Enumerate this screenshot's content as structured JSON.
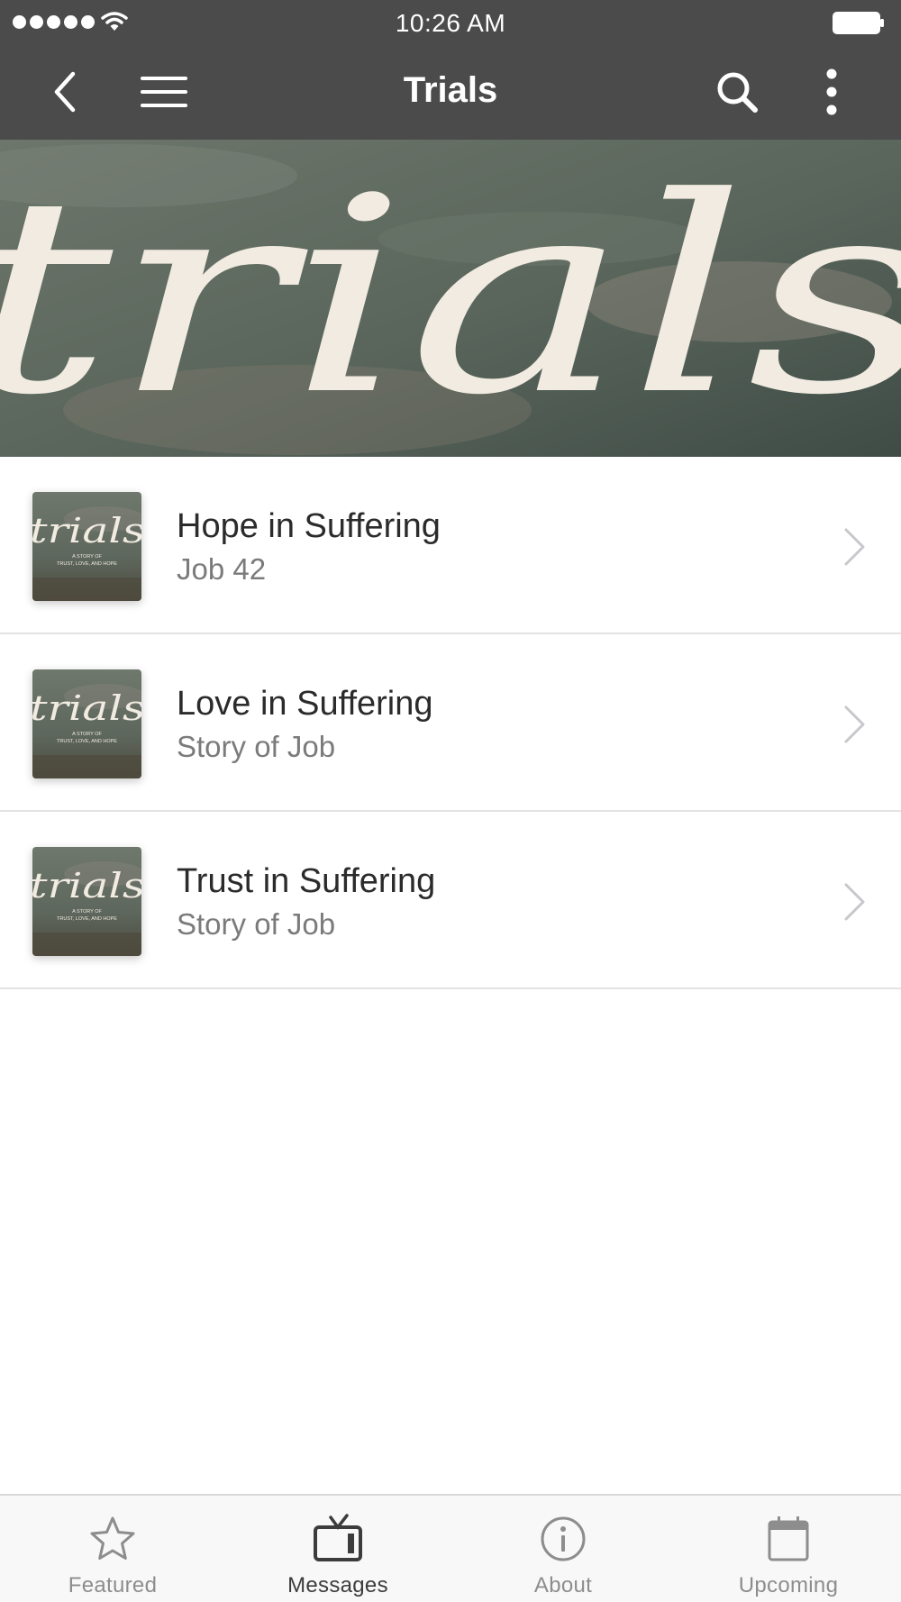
{
  "status_bar": {
    "time": "10:26 AM"
  },
  "nav": {
    "title": "Trials",
    "back_icon": "chevron-left-icon",
    "menu_icon": "hamburger-icon",
    "search_icon": "search-icon",
    "more_icon": "more-vertical-icon"
  },
  "banner": {
    "text": "trials"
  },
  "thumbnail": {
    "title": "trials",
    "caption_line1": "A STORY OF",
    "caption_line2": "TRUST, LOVE, AND HOPE"
  },
  "messages": [
    {
      "title": "Hope in Suffering",
      "subtitle": "Job 42"
    },
    {
      "title": "Love in Suffering",
      "subtitle": "Story of Job"
    },
    {
      "title": "Trust in Suffering",
      "subtitle": "Story of Job"
    }
  ],
  "tabs": [
    {
      "label": "Featured",
      "icon": "star-icon",
      "active": false
    },
    {
      "label": "Messages",
      "icon": "tv-icon",
      "active": true
    },
    {
      "label": "About",
      "icon": "info-icon",
      "active": false
    },
    {
      "label": "Upcoming",
      "icon": "calendar-icon",
      "active": false
    }
  ],
  "colors": {
    "bar": "#4a4b4a",
    "banner_text": "#f1ebe1",
    "active_tab": "#3c3c3c",
    "inactive_tab": "#8d8d8d"
  }
}
